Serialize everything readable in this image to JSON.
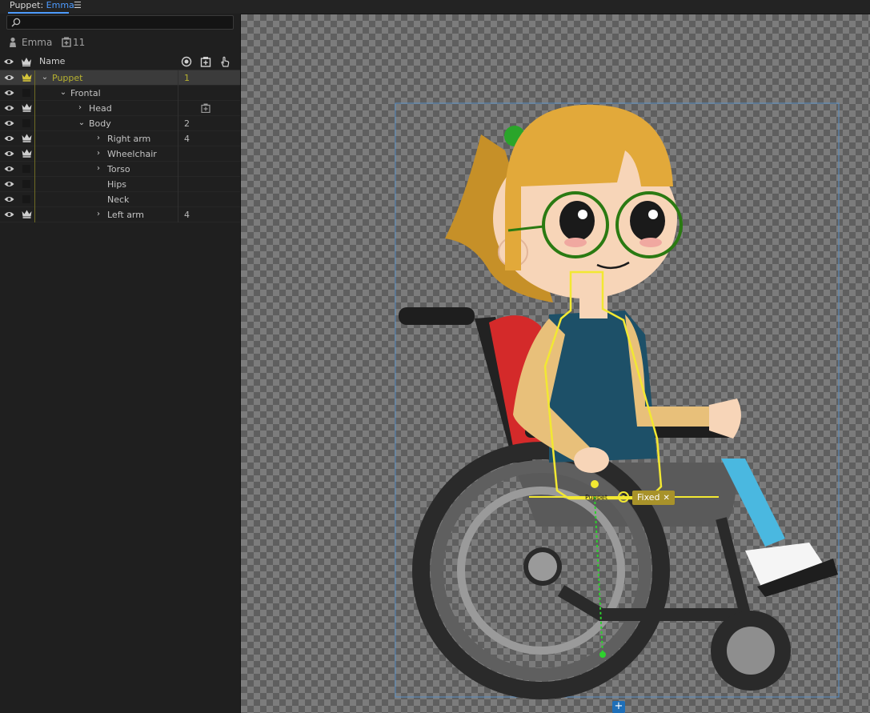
{
  "tab": {
    "prefix": "Puppet: ",
    "name": "Emma"
  },
  "search": {
    "value": "",
    "placeholder": ""
  },
  "summary": {
    "puppet": "Emma",
    "count": "11"
  },
  "columns": {
    "name": "Name"
  },
  "rows": [
    {
      "label": "Puppet",
      "num": "1",
      "crown": true,
      "chevron": "down",
      "selected": true
    },
    {
      "label": "Frontal",
      "num": "",
      "crown": false,
      "chevron": "down"
    },
    {
      "label": "Head",
      "num": "",
      "crown": true,
      "chevron": "right",
      "icon": "plus-square-icon"
    },
    {
      "label": "Body",
      "num": "2",
      "crown": false,
      "chevron": "down"
    },
    {
      "label": "Right arm",
      "num": "4",
      "crown": true,
      "chevron": "right"
    },
    {
      "label": "Wheelchair",
      "num": "",
      "crown": true,
      "chevron": "right"
    },
    {
      "label": "Torso",
      "num": "",
      "crown": false,
      "chevron": "right"
    },
    {
      "label": "Hips",
      "num": "",
      "crown": false,
      "chevron": "none"
    },
    {
      "label": "Neck",
      "num": "",
      "crown": false,
      "chevron": "none"
    },
    {
      "label": "Left arm",
      "num": "4",
      "crown": true,
      "chevron": "right"
    }
  ],
  "canvas": {
    "handle_label": "Puppet",
    "fixed_tag": "Fixed",
    "add_button": "+"
  },
  "colors": {
    "accent": "#4d9bff",
    "selection": "#b7b230",
    "handle": "#f2e832"
  }
}
